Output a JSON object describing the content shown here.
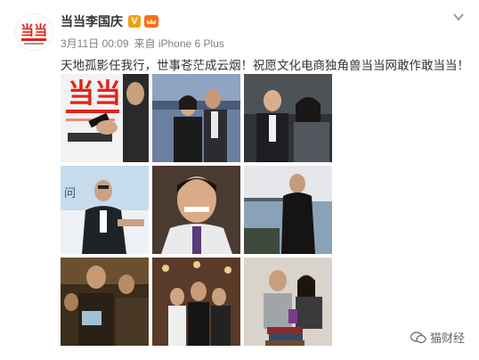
{
  "profile": {
    "name": "当当李国庆",
    "verified_badge": "V"
  },
  "meta": {
    "date": "3月11日 00:09",
    "source": "来自 iPhone 6 Plus"
  },
  "post": {
    "text": "天地孤影任我行，世事苍茫成云烟！祝愿文化电商独角兽当当网敢作敢当当！"
  },
  "photos": [
    {
      "alt": "dangdang-logo-phone"
    },
    {
      "alt": "couple-at-event"
    },
    {
      "alt": "couple-smiling"
    },
    {
      "alt": "man-seated-interview"
    },
    {
      "alt": "man-smiling-portrait"
    },
    {
      "alt": "man-by-waterfront"
    },
    {
      "alt": "crowd-at-dinner"
    },
    {
      "alt": "group-photo-lights"
    },
    {
      "alt": "couple-with-books"
    }
  ],
  "watermark": {
    "text": "猫财经"
  },
  "colors": {
    "accent": "#e2231a",
    "badge": "#f0a010"
  }
}
